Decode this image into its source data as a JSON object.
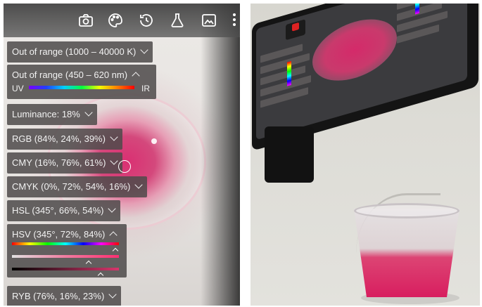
{
  "left_panel": {
    "toolbar": {
      "icons": [
        "camera-icon",
        "palette-icon",
        "history-icon",
        "flask-icon",
        "image-icon",
        "more-vertical-icon"
      ]
    },
    "chips": {
      "kelvin": "Out of range (1000 – 40000 K)",
      "wavelength": "Out of range (450 – 620 nm)",
      "uv_label": "UV",
      "ir_label": "IR",
      "luminance": "Luminance: 18%",
      "rgb": "RGB (84%, 24%, 39%)",
      "cmy": "CMY (16%, 76%, 61%)",
      "cmyk": "CMYK (0%, 72%, 54%, 16%)",
      "hsl": "HSL (345°, 66%, 54%)",
      "hsv": "HSV (345°, 72%, 84%)",
      "ryb": "RYB (76%, 16%, 23%)"
    },
    "sample_color": "#d63d63"
  },
  "right_panel": {
    "liquid_color": "#d81e5f",
    "phone_color": "#141414"
  }
}
